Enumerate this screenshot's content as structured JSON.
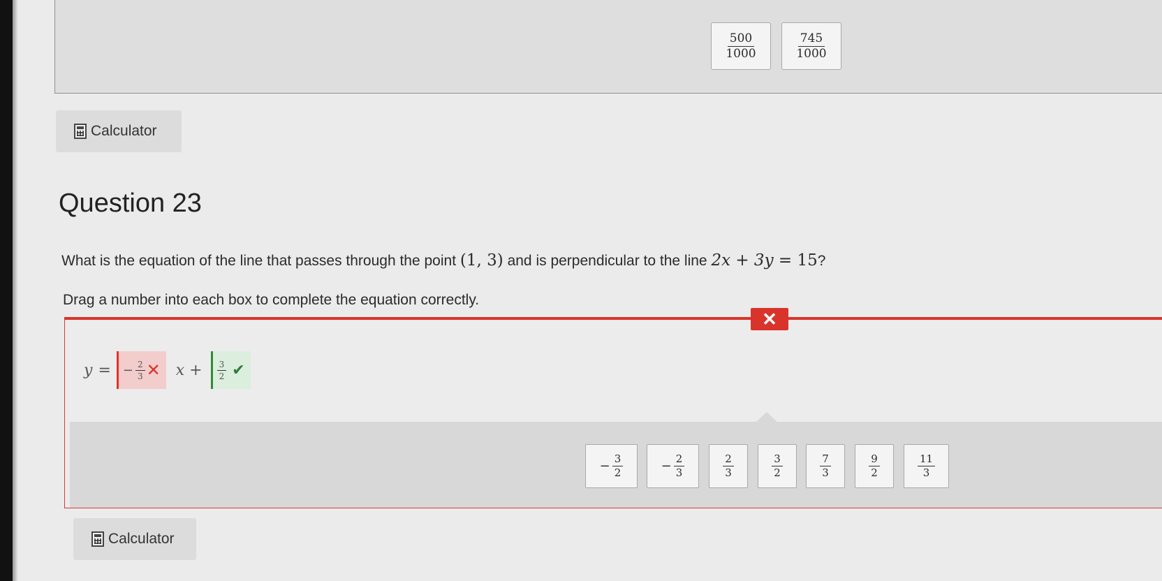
{
  "prev_answers": [
    {
      "num": "500",
      "den": "1000"
    },
    {
      "num": "745",
      "den": "1000"
    }
  ],
  "calculator_label": "Calculator",
  "question": {
    "title": "Question 23",
    "text_part1": "What is the equation of the line that passes through the point ",
    "point": "(1, 3)",
    "text_part2": " and is perpendicular to the line ",
    "line_eq_lhs": "2x + 3y",
    "line_eq_eq": " = 15",
    "text_end": "?",
    "instruction": "Drag a number into each box to complete the equation correctly."
  },
  "feedback": {
    "badge": "✕"
  },
  "equation": {
    "y": "y",
    "equals": "=",
    "x_plus": "x +",
    "slope": {
      "sign": "−",
      "num": "2",
      "den": "3",
      "status": "incorrect",
      "mark": "✕"
    },
    "intercept": {
      "sign": "",
      "num": "3",
      "den": "2",
      "status": "correct",
      "mark": "✔"
    }
  },
  "choices": [
    {
      "sign": "−",
      "num": "3",
      "den": "2"
    },
    {
      "sign": "−",
      "num": "2",
      "den": "3"
    },
    {
      "sign": "",
      "num": "2",
      "den": "3"
    },
    {
      "sign": "",
      "num": "3",
      "den": "2"
    },
    {
      "sign": "",
      "num": "7",
      "den": "3"
    },
    {
      "sign": "",
      "num": "9",
      "den": "2"
    },
    {
      "sign": "",
      "num": "11",
      "den": "3"
    }
  ]
}
